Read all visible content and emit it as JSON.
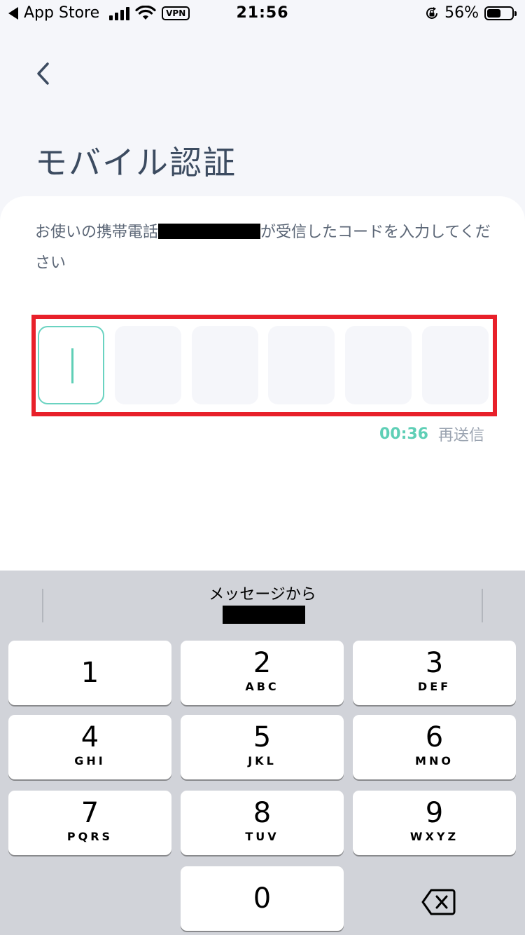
{
  "status_bar": {
    "back_app": "App Store",
    "vpn": "VPN",
    "time": "21:56",
    "battery": "56%",
    "battery_level": 0.56
  },
  "header": {
    "title": "モバイル認証"
  },
  "card": {
    "instruction_before": "お使いの携帯電話",
    "instruction_after": "が受信したコードを入力してください"
  },
  "code_input": {
    "length": 6,
    "active_index": 0
  },
  "timer": {
    "countdown": "00:36",
    "resend_label": "再送信"
  },
  "keyboard": {
    "suggestion_label": "メッセージから",
    "keys": [
      {
        "digit": "1",
        "letters": ""
      },
      {
        "digit": "2",
        "letters": "ABC"
      },
      {
        "digit": "3",
        "letters": "DEF"
      },
      {
        "digit": "4",
        "letters": "GHI"
      },
      {
        "digit": "5",
        "letters": "JKL"
      },
      {
        "digit": "6",
        "letters": "MNO"
      },
      {
        "digit": "7",
        "letters": "PQRS"
      },
      {
        "digit": "8",
        "letters": "TUV"
      },
      {
        "digit": "9",
        "letters": "WXYZ"
      },
      {
        "digit": "0",
        "letters": ""
      }
    ]
  },
  "colors": {
    "accent": "#5fcfb6",
    "highlight": "#e8202a",
    "title": "#3c4b60"
  }
}
